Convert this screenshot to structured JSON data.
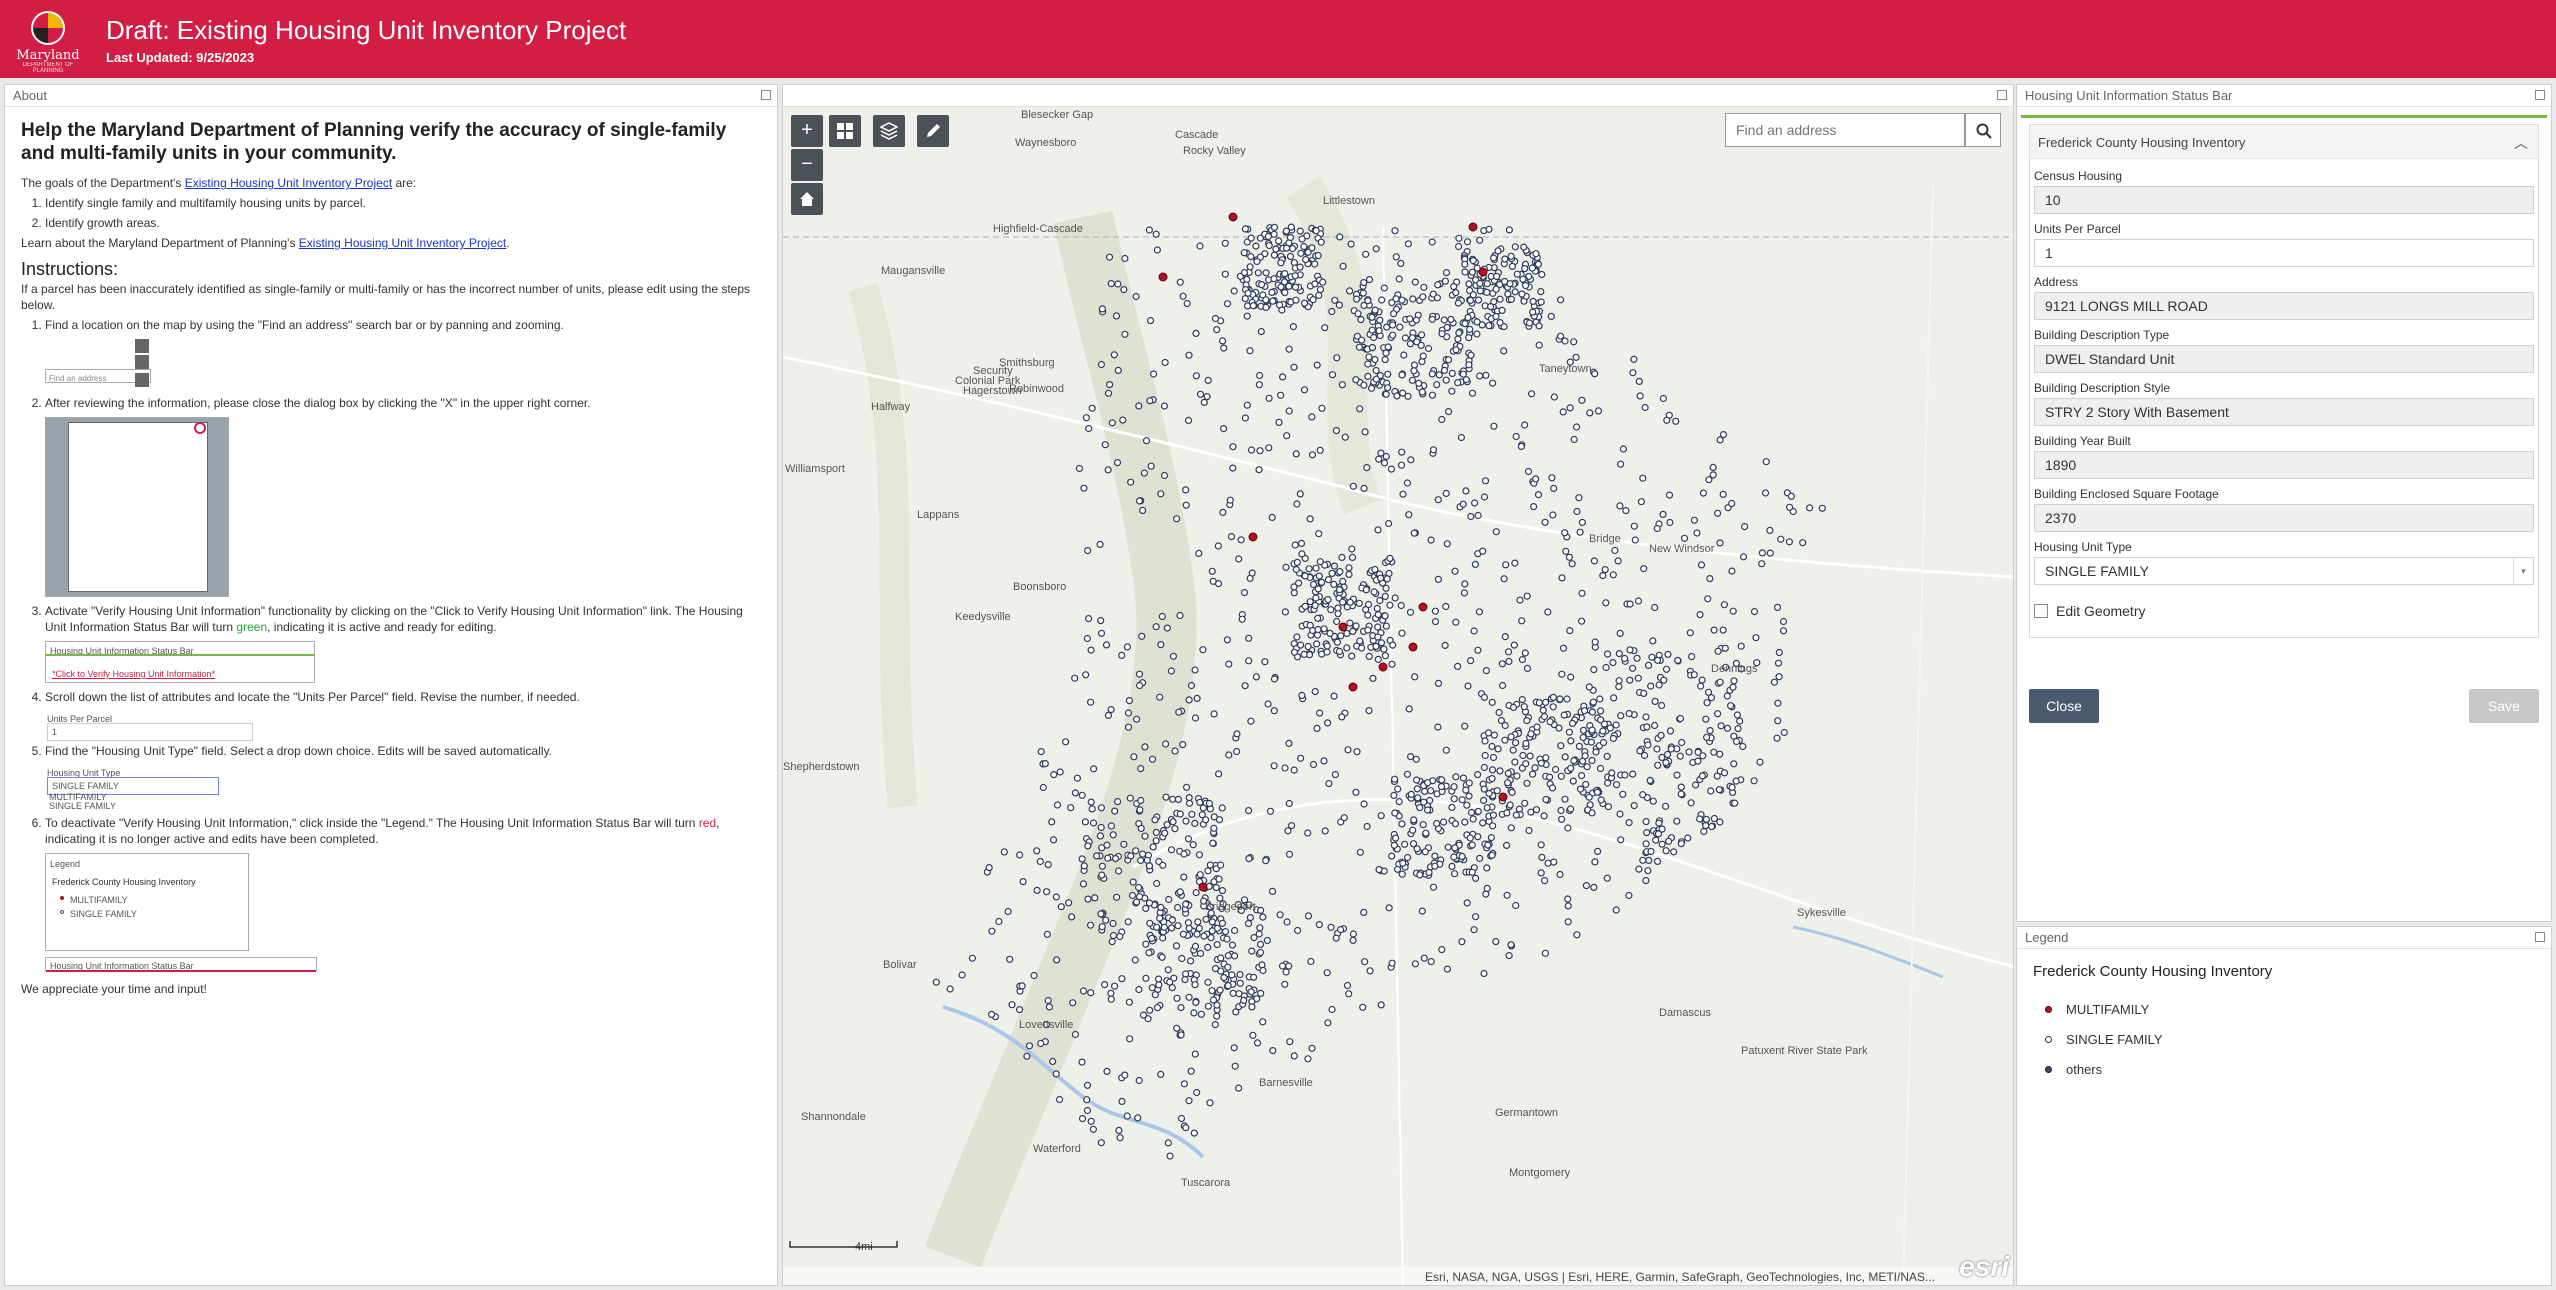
{
  "header": {
    "logo_name": "Maryland",
    "logo_sub": "DEPARTMENT OF PLANNING",
    "title": "Draft: Existing Housing Unit Inventory Project",
    "last_updated": "Last Updated: 9/25/2023",
    "color": "#d21d45"
  },
  "about": {
    "panel_title": "About",
    "heading": "Help the Maryland Department of Planning verify the accuracy of single-family and multi-family units in your community.",
    "goals_pre": "The goals of the Department's ",
    "goals_link": "Existing Housing Unit Inventory Project",
    "goals_post": " are:",
    "goals": [
      "Identify single family and multifamily housing units by parcel.",
      "Identify growth areas."
    ],
    "learn_pre": "Learn about the Maryland Department of Planning's ",
    "learn_link": "Existing Housing Unit Inventory Project",
    "learn_post": ".",
    "instructions_title": "Instructions:",
    "instructions_intro": "If a parcel has been inaccurately identified as single-family or multi-family or has the incorrect number of units, please edit using the steps below.",
    "steps": {
      "s1": "Find a location on the map by using the \"Find an address\" search bar or by panning and zooming.",
      "s2": "After reviewing the information, please close the dialog box by clicking the \"X\" in the upper right corner.",
      "s3_pre": "Activate \"Verify Housing Unit Information\" functionality by clicking on the \"Click to Verify Housing Unit Information\" link. The Housing Unit Information Status Bar will turn ",
      "s3_color": "green",
      "s3_post": ", indicating it is active and ready for editing.",
      "s4": "Scroll down the list of attributes and locate the \"Units Per Parcel\" field. Revise the number, if needed.",
      "s5": "Find the \"Housing Unit Type\" field.  Select a drop down choice. Edits will be saved automatically.",
      "s6_pre": "To deactivate \"Verify Housing Unit Information,\" click inside the \"Legend.\" The Housing Unit Information Status Bar will turn ",
      "s6_color": "red",
      "s6_post": ", indicating it is no longer active and edits have been completed."
    },
    "thumbs": {
      "search_placeholder": "Find an address",
      "status_bar_title": "Housing Unit Information Status Bar",
      "verify_link": "*Click to Verify Housing Unit Information*",
      "units_label": "Units Per Parcel",
      "units_value": "1",
      "type_label": "Housing Unit Type",
      "type_value": "SINGLE FAMILY",
      "type_opt1": "MULTIFAMILY",
      "type_opt2": "SINGLE FAMILY",
      "legend_title": "Legend",
      "legend_layer": "Frederick County Housing Inventory",
      "legend_multi": "MULTIFAMILY",
      "legend_single": "SINGLE FAMILY"
    },
    "closing": "We appreciate your time and input!"
  },
  "map": {
    "search_placeholder": "Find an address",
    "attribution": "Esri, NASA, NGA, USGS | Esri, HERE, Garmin, SafeGraph, GeoTechnologies, Inc, METI/NAS...",
    "esri": "esri",
    "scale": "4mi",
    "places": [
      "Blesecker Gap",
      "Waynesboro",
      "Cascade",
      "Rocky Valley",
      "Littlestown",
      "Maugansville",
      "Highfield-Cascade",
      "Taneytown",
      "Security",
      "Hagerstown",
      "Smithsburg",
      "Robinwood",
      "Colonial Park",
      "Halfway",
      "Williamsport",
      "Lappans",
      "Boonsboro",
      "Keedysville",
      "New Windsor",
      "Bridge",
      "Dennings",
      "Shepherdstown",
      "Bolivar",
      "Lovettsville",
      "Damascus",
      "Barnesville",
      "Germantown",
      "Shannondale",
      "Waterford",
      "Montgomery",
      "Tuscarora",
      "Patuxent River State Park",
      "Bridgeport",
      "Sykesville"
    ]
  },
  "status_bar": {
    "panel_title": "Housing Unit Information Status Bar",
    "layer": "Frederick County Housing Inventory",
    "fields": [
      {
        "label": "Census Housing",
        "value": "10"
      },
      {
        "label": "Units Per Parcel",
        "value": "1"
      },
      {
        "label": "Address",
        "value": "9121 LONGS MILL ROAD"
      },
      {
        "label": "Building Description Type",
        "value": "DWEL Standard Unit"
      },
      {
        "label": "Building Description Style",
        "value": "STRY 2 Story With Basement"
      },
      {
        "label": "Building Year Built",
        "value": "1890"
      },
      {
        "label": "Building Enclosed Square Footage",
        "value": "2370"
      },
      {
        "label": "Housing Unit Type",
        "value": "SINGLE FAMILY"
      }
    ],
    "edit_geometry": "Edit Geometry",
    "close": "Close",
    "save": "Save",
    "active_color": "#79b842"
  },
  "legend": {
    "panel_title": "Legend",
    "layer": "Frederick County Housing Inventory",
    "items": [
      {
        "label": "MULTIFAMILY",
        "color": "#b0102a"
      },
      {
        "label": "SINGLE FAMILY",
        "color": "#ffffff"
      },
      {
        "label": "others",
        "color": "#3d4a66"
      }
    ]
  }
}
